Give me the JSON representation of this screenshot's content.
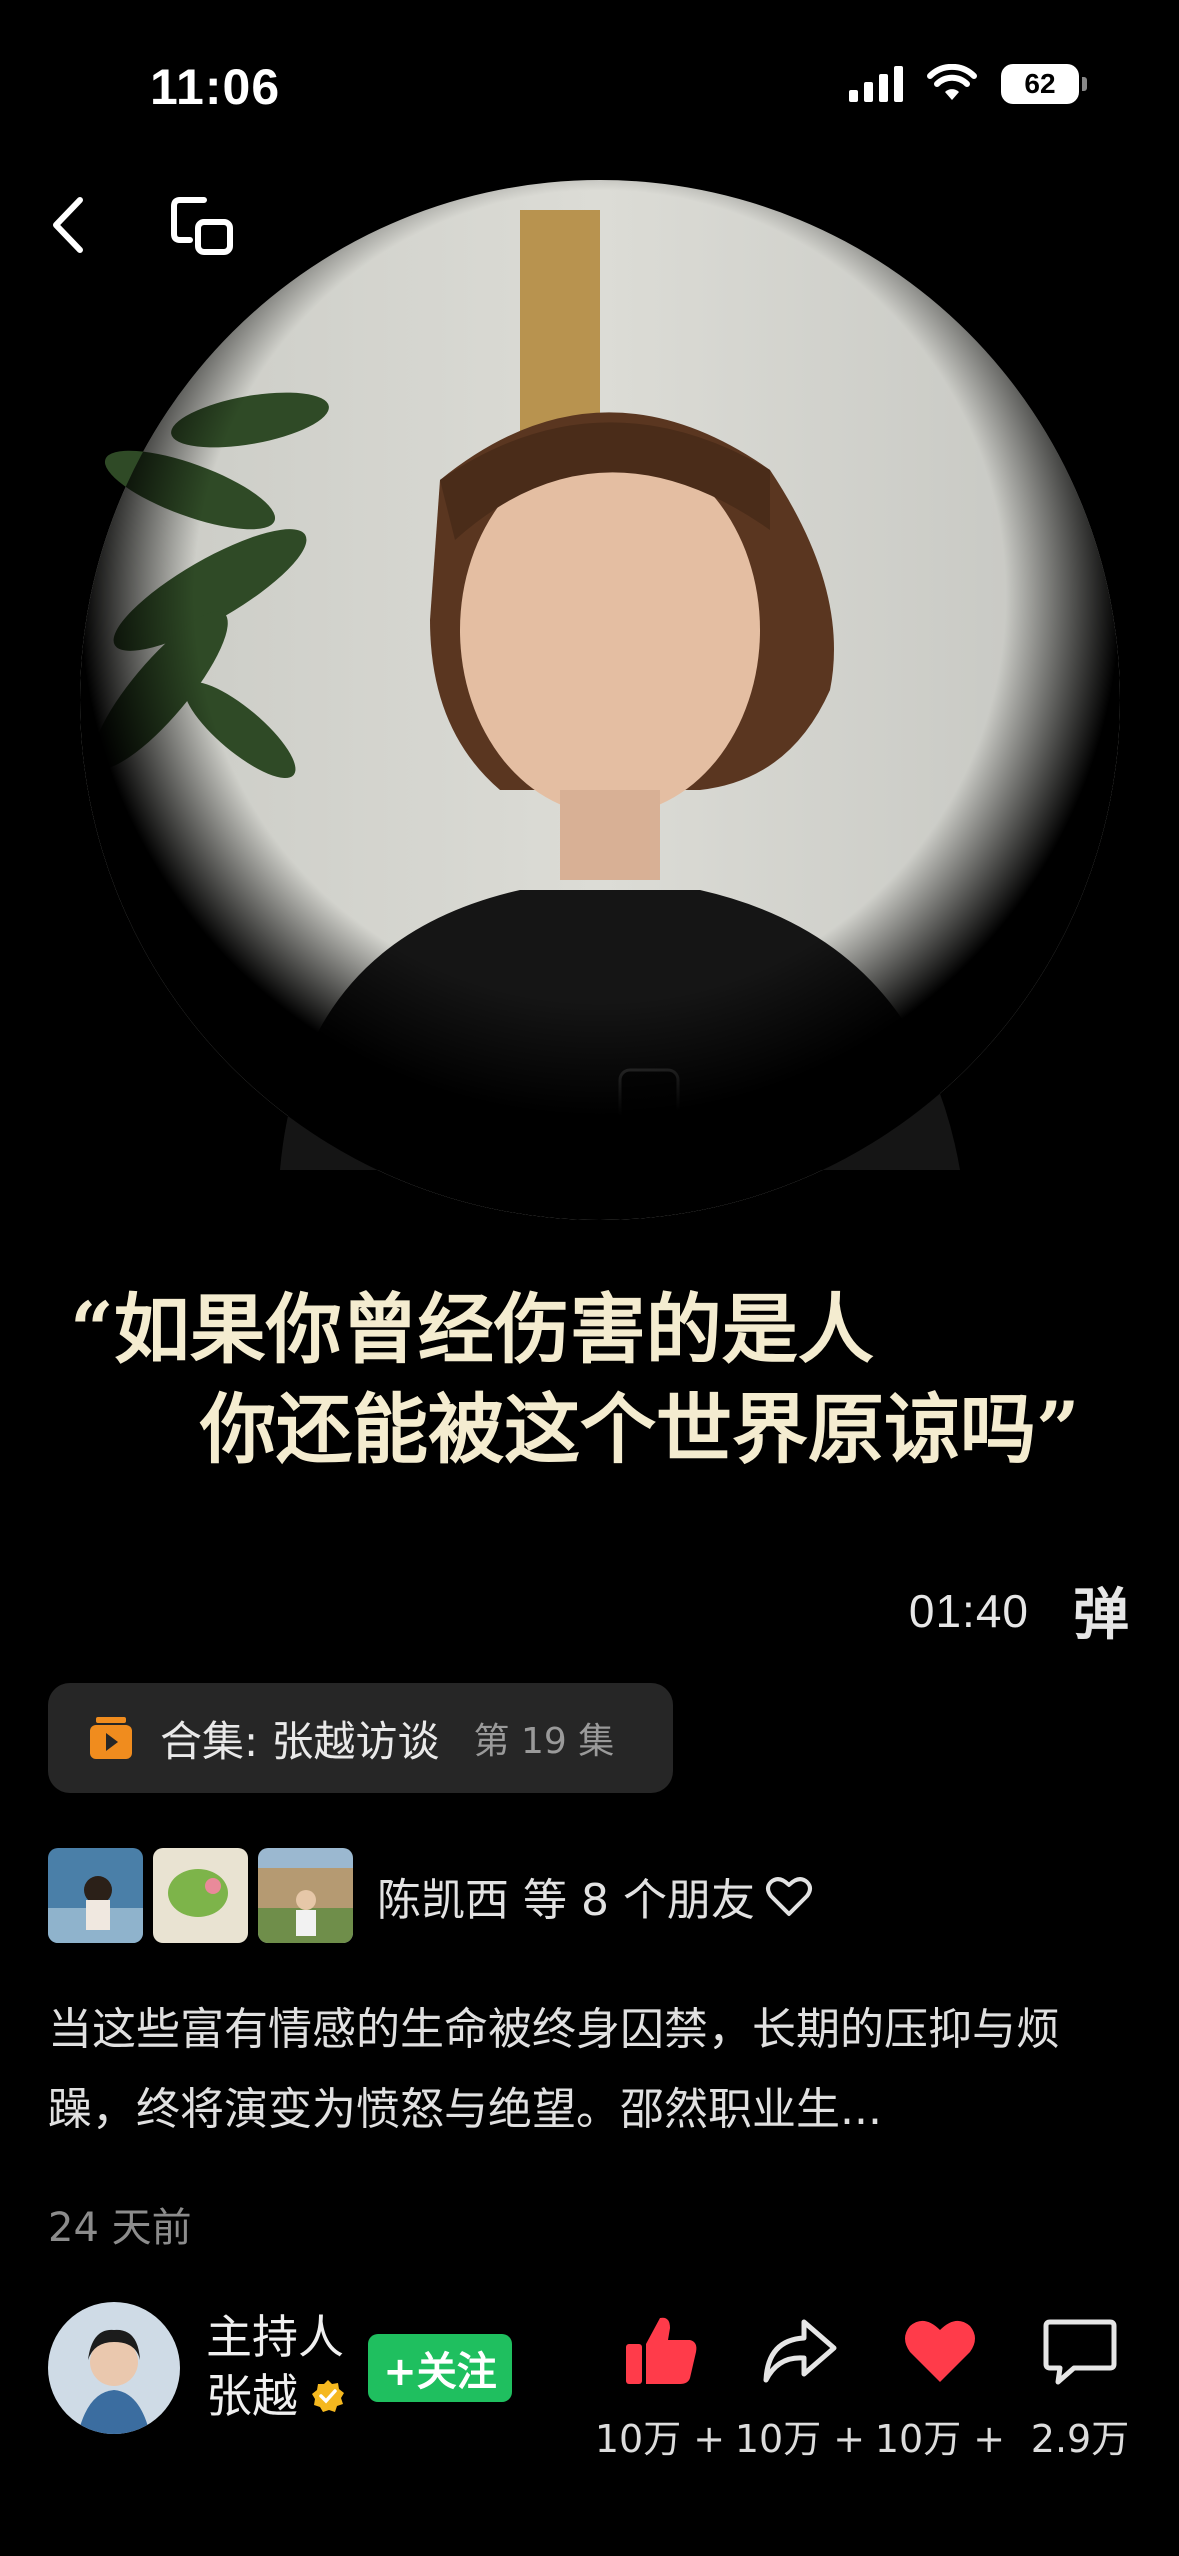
{
  "status_bar": {
    "time": "11:06",
    "battery": "62"
  },
  "video": {
    "quote_line1": "“如果你曾经伤害的是人",
    "quote_line2": "你还能被这个世界原谅吗”",
    "duration": "01:40",
    "danmu_label": "弹"
  },
  "collection": {
    "label": "合集: 张越访谈",
    "episode": "第 19 集"
  },
  "friends": {
    "text": "陈凯西 等 8 个朋友"
  },
  "description": "当这些富有情感的生命被终身囚禁，长期的压抑与烦躁，终将演变为愤怒与绝望。邵然职业生...",
  "posted_ago": "24 天前",
  "author": {
    "role": "主持人",
    "name": "张越",
    "follow_label": "+关注"
  },
  "actions": {
    "like": "10万 +",
    "share": "10万 +",
    "favorite": "10万 +",
    "comment": "2.9万"
  },
  "colors": {
    "follow": "#1fbf5f",
    "like": "#ff3b4a",
    "favorite": "#ff3b4a",
    "quote": "#f4ecd0"
  }
}
